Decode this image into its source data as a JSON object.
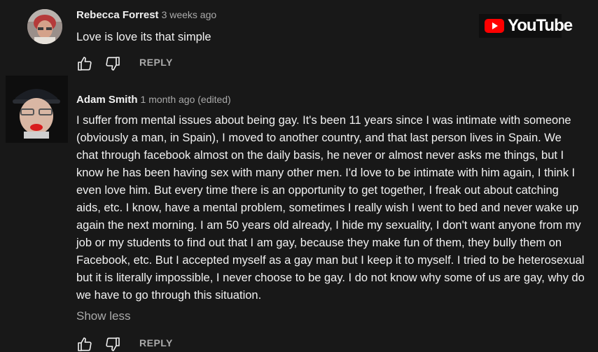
{
  "brand": {
    "name": "YouTube",
    "accent": "#ff0000"
  },
  "comments": [
    {
      "author": "Rebecca Forrest",
      "time": "3 weeks ago",
      "text": "Love is love its that simple",
      "reply_label": "REPLY",
      "icons": {
        "like": "thumb-up-icon",
        "dislike": "thumb-down-icon"
      }
    },
    {
      "author": "Adam Smith",
      "time": "1 month ago (edited)",
      "text": "I suffer from mental issues about being gay. It's been 11 years since I was intimate with someone (obviously a man, in Spain), I moved to another country, and that last person lives in Spain. We chat through facebook almost on the daily basis, he never or almost never asks me things, but I know he has been having sex with many other men. I'd love to be intimate with him again, I think I even love him. But every time there is an opportunity to get together, I freak out about catching aids, etc. I know, have a mental problem, sometimes I really wish I went to bed and never wake up again the next morning. I am 50 years old already, I hide my sexuality, I don't want anyone from my job or my students to find out that I am gay, because they make fun of them, they bully them on Facebook, etc. But I accepted myself as a gay man but I keep it to myself. I tried to be heterosexual but it is literally impossible, I never choose to be gay. I do not know why some of us are gay, why do we have to go through this situation.",
      "show_less_label": "Show less",
      "reply_label": "REPLY",
      "icons": {
        "like": "thumb-up-icon",
        "dislike": "thumb-down-icon"
      }
    }
  ]
}
